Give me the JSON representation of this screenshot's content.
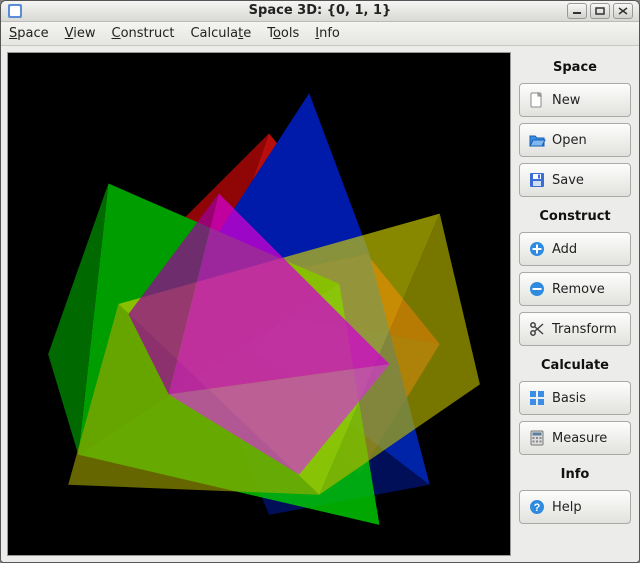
{
  "window": {
    "title": "Space 3D: {0, 1, 1}"
  },
  "menubar": {
    "space": "Space",
    "view": "View",
    "construct": "Construct",
    "calculate": "Calculate",
    "tools": "Tools",
    "info": "Info"
  },
  "sidebar": {
    "space": {
      "heading": "Space",
      "new": "New",
      "open": "Open",
      "save": "Save"
    },
    "construct": {
      "heading": "Construct",
      "add": "Add",
      "remove": "Remove",
      "transform": "Transform"
    },
    "calculate": {
      "heading": "Calculate",
      "basis": "Basis",
      "measure": "Measure"
    },
    "info": {
      "heading": "Info",
      "help": "Help"
    }
  }
}
